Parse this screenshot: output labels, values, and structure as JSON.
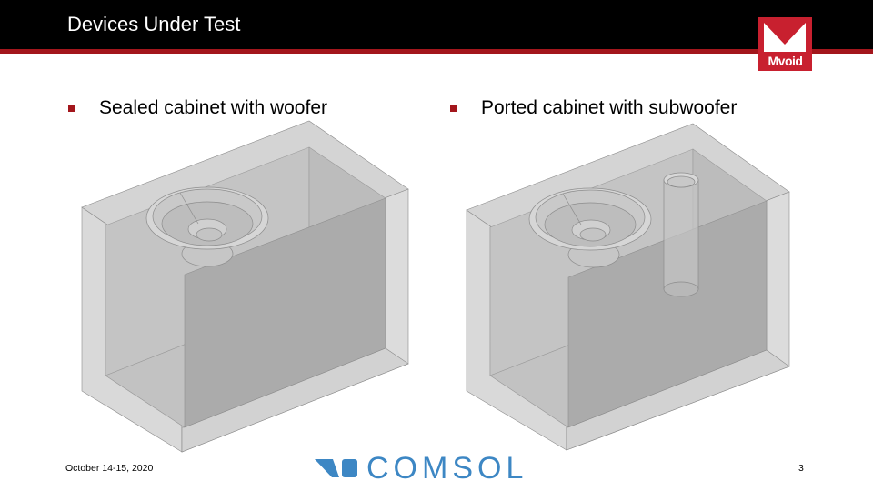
{
  "slide": {
    "title": "Devices Under Test",
    "page_number": "3",
    "date": "October 14-15, 2020"
  },
  "logo": {
    "text": "Mvoid",
    "color": "#c8202f"
  },
  "sponsor_logo": {
    "text": "COMSOL",
    "color": "#3d87c4"
  },
  "bullets": [
    {
      "label": "Sealed cabinet with woofer"
    },
    {
      "label": "Ported cabinet with subwoofer"
    }
  ],
  "figures": [
    {
      "name": "sealed-cabinet",
      "components": [
        "cabinet",
        "woofer"
      ]
    },
    {
      "name": "ported-cabinet",
      "components": [
        "cabinet",
        "subwoofer",
        "port-tube"
      ]
    }
  ],
  "colors": {
    "header": "#000000",
    "accent": "#a3161c"
  }
}
